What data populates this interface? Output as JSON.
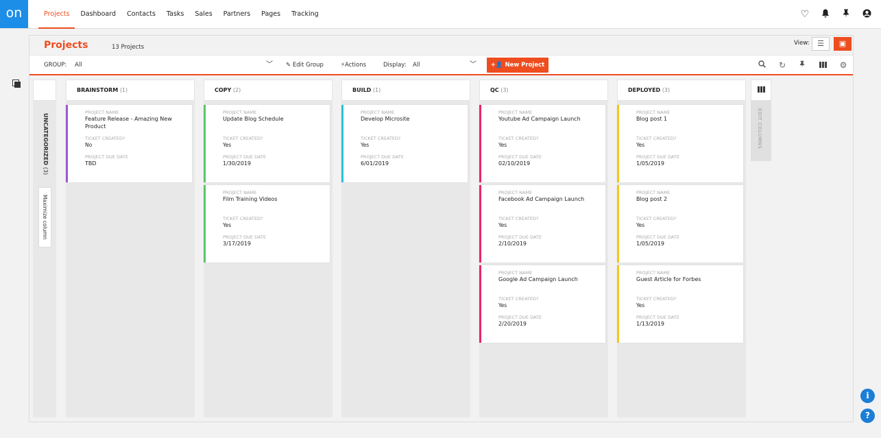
{
  "app": {
    "logo_text": "on"
  },
  "nav": {
    "items": [
      {
        "label": "Projects",
        "active": true
      },
      {
        "label": "Dashboard"
      },
      {
        "label": "Contacts"
      },
      {
        "label": "Tasks"
      },
      {
        "label": "Sales"
      },
      {
        "label": "Partners"
      },
      {
        "label": "Pages"
      },
      {
        "label": "Tracking"
      }
    ],
    "icons": [
      "heart-icon",
      "bell-icon",
      "pin-icon",
      "user-icon"
    ]
  },
  "header": {
    "title": "Projects",
    "count": "13 Projects",
    "view_label": "View:",
    "view_icons": [
      "list-view-icon",
      "board-view-icon"
    ]
  },
  "toolbar": {
    "group_label": "GROUP:",
    "group_value": "All",
    "edit_group": "Edit Group",
    "actions": "Actions",
    "display_label": "Display:",
    "display_value": "All",
    "new_project": "New Project",
    "right_icons": [
      "search-icon",
      "refresh-icon",
      "pin-icon",
      "columns-icon",
      "settings-icon"
    ]
  },
  "uncategorized": {
    "label": "UNCATEGORIZED",
    "count": "(3)",
    "maximize": "Maximize column"
  },
  "edit_columns": {
    "label": "EDIT COLUMNS"
  },
  "labels": {
    "project_name": "PROJECT NAME",
    "ticket_created": "TICKET CREATED?",
    "due_date": "PROJECT DUE DATE"
  },
  "columns": [
    {
      "title": "BRAINSTORM",
      "count": "(1)",
      "color": "#9b59d0",
      "cards": [
        {
          "name": "Feature Release - Amazing New Product",
          "ticket": "No",
          "due": "TBD"
        }
      ]
    },
    {
      "title": "COPY",
      "count": "(2)",
      "color": "#5cc46a",
      "cards": [
        {
          "name": "Update Blog Schedule",
          "ticket": "Yes",
          "due": "1/30/2019"
        },
        {
          "name": "Film Training Videos",
          "ticket": "Yes",
          "due": "3/17/2019"
        }
      ]
    },
    {
      "title": "BUILD",
      "count": "(1)",
      "color": "#2bbfd9",
      "cards": [
        {
          "name": "Develop Microsite",
          "ticket": "Yes",
          "due": "6/01/2019"
        }
      ]
    },
    {
      "title": "QC",
      "count": "(3)",
      "color": "#e8256d",
      "cards": [
        {
          "name": "Youtube Ad Campaign Launch",
          "ticket": "Yes",
          "due": "02/10/2019"
        },
        {
          "name": "Facebook Ad Campaign Launch",
          "ticket": "Yes",
          "due": "2/10/2019"
        },
        {
          "name": "Google Ad Campaign Launch",
          "ticket": "Yes",
          "due": "2/20/2019"
        }
      ]
    },
    {
      "title": "DEPLOYED",
      "count": "(3)",
      "color": "#f5c518",
      "cards": [
        {
          "name": "Blog post 1",
          "ticket": "Yes",
          "due": "1/05/2019"
        },
        {
          "name": "Blog post 2",
          "ticket": "Yes",
          "due": "1/05/2019"
        },
        {
          "name": "Guest Article for Forbes",
          "ticket": "Yes",
          "due": "1/13/2019"
        }
      ]
    }
  ],
  "help": {
    "info_icon": "info-icon",
    "help_icon": "help-icon"
  },
  "colors": {
    "accent": "#ee4d1f",
    "logo": "#1c8ee8"
  }
}
